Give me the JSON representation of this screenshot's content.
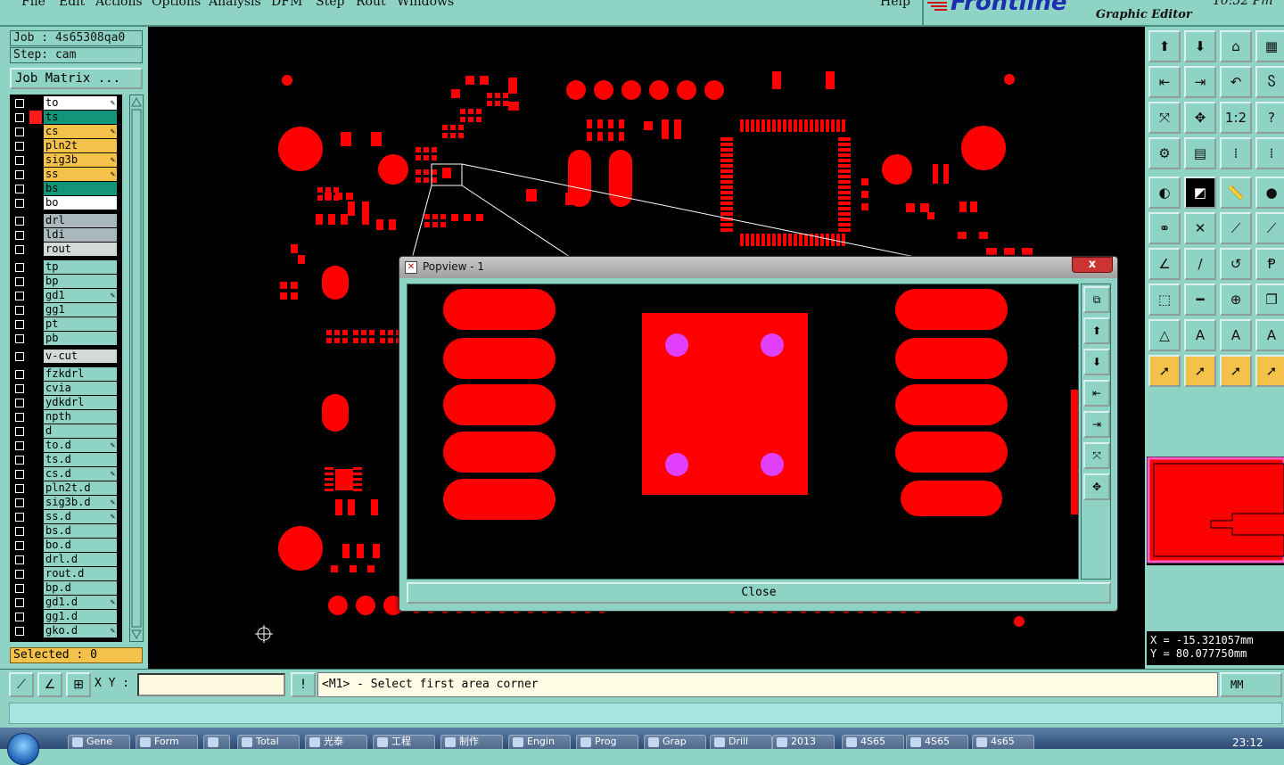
{
  "menu": {
    "items": [
      "File",
      "Edit",
      "Actions",
      "Options",
      "Analysis",
      "DFM",
      "Step",
      "Rout",
      "Windows"
    ],
    "help": "Help"
  },
  "brand": {
    "logo": "Frontline",
    "subtitle": "Graphic Editor",
    "clock": "10:52 Pm"
  },
  "job": {
    "job_line": "Job : 4s65308qa0",
    "step_line": "Step: cam",
    "matrix_button": "Job Matrix ..."
  },
  "layers": [
    {
      "name": "to",
      "bg": "#ffffff",
      "mark": "#000000",
      "edit": true
    },
    {
      "name": "ts",
      "bg": "#12967a",
      "mark": "#ff1a1a",
      "edit": false
    },
    {
      "name": "cs",
      "bg": "#f4c24a",
      "mark": "#000000",
      "edit": true
    },
    {
      "name": "pln2t",
      "bg": "#f4c24a",
      "mark": "#000000",
      "edit": false
    },
    {
      "name": "sig3b",
      "bg": "#f4c24a",
      "mark": "#000000",
      "edit": true
    },
    {
      "name": "ss",
      "bg": "#f4c24a",
      "mark": "#000000",
      "edit": true
    },
    {
      "name": "bs",
      "bg": "#12967a",
      "mark": "#000000",
      "edit": false
    },
    {
      "name": "bo",
      "bg": "#ffffff",
      "mark": "#000000",
      "edit": false
    },
    {
      "name": "drl",
      "bg": "#a9b8bc",
      "mark": "#000000",
      "edit": false
    },
    {
      "name": "ldi",
      "bg": "#a9b8bc",
      "mark": "#000000",
      "edit": false
    },
    {
      "name": "rout",
      "bg": "#d5d8d8",
      "mark": "#000000",
      "edit": false
    },
    {
      "name": "tp",
      "bg": "#8fd3c4",
      "mark": "#000000",
      "edit": false
    },
    {
      "name": "bp",
      "bg": "#8fd3c4",
      "mark": "#000000",
      "edit": false
    },
    {
      "name": "gd1",
      "bg": "#8fd3c4",
      "mark": "#000000",
      "edit": true
    },
    {
      "name": "gg1",
      "bg": "#8fd3c4",
      "mark": "#000000",
      "edit": false
    },
    {
      "name": "pt",
      "bg": "#8fd3c4",
      "mark": "#000000",
      "edit": false
    },
    {
      "name": "pb",
      "bg": "#8fd3c4",
      "mark": "#000000",
      "edit": false
    },
    {
      "name": "v-cut",
      "bg": "#d5d8d8",
      "mark": "#000000",
      "edit": false
    },
    {
      "name": "fzkdrl",
      "bg": "#8fd3c4",
      "mark": "#000000",
      "edit": false
    },
    {
      "name": "cvia",
      "bg": "#8fd3c4",
      "mark": "#000000",
      "edit": false
    },
    {
      "name": "ydkdrl",
      "bg": "#8fd3c4",
      "mark": "#000000",
      "edit": false
    },
    {
      "name": "npth",
      "bg": "#8fd3c4",
      "mark": "#000000",
      "edit": false
    },
    {
      "name": "d",
      "bg": "#8fd3c4",
      "mark": "#000000",
      "edit": false
    },
    {
      "name": "to.d",
      "bg": "#8fd3c4",
      "mark": "#000000",
      "edit": true
    },
    {
      "name": "ts.d",
      "bg": "#8fd3c4",
      "mark": "#000000",
      "edit": false
    },
    {
      "name": "cs.d",
      "bg": "#8fd3c4",
      "mark": "#000000",
      "edit": true
    },
    {
      "name": "pln2t.d",
      "bg": "#8fd3c4",
      "mark": "#000000",
      "edit": false
    },
    {
      "name": "sig3b.d",
      "bg": "#8fd3c4",
      "mark": "#000000",
      "edit": true
    },
    {
      "name": "ss.d",
      "bg": "#8fd3c4",
      "mark": "#000000",
      "edit": true
    },
    {
      "name": "bs.d",
      "bg": "#8fd3c4",
      "mark": "#000000",
      "edit": false
    },
    {
      "name": "bo.d",
      "bg": "#8fd3c4",
      "mark": "#000000",
      "edit": false
    },
    {
      "name": "drl.d",
      "bg": "#8fd3c4",
      "mark": "#000000",
      "edit": false
    },
    {
      "name": "rout.d",
      "bg": "#8fd3c4",
      "mark": "#000000",
      "edit": false
    },
    {
      "name": "bp.d",
      "bg": "#8fd3c4",
      "mark": "#000000",
      "edit": false
    },
    {
      "name": "gd1.d",
      "bg": "#8fd3c4",
      "mark": "#000000",
      "edit": true
    },
    {
      "name": "gg1.d",
      "bg": "#8fd3c4",
      "mark": "#000000",
      "edit": false
    },
    {
      "name": "gko.d",
      "bg": "#8fd3c4",
      "mark": "#000000",
      "edit": true
    }
  ],
  "selected": "Selected : 0",
  "popview": {
    "title": "Popview - 1",
    "close_button": "Close",
    "close_x": "x"
  },
  "right_tools": [
    {
      "icon": "open-job-icon",
      "glyph": "⬆"
    },
    {
      "icon": "save-icon",
      "glyph": "⬇"
    },
    {
      "icon": "home-icon",
      "glyph": "⌂"
    },
    {
      "icon": "matrix-icon",
      "glyph": "▦"
    },
    {
      "icon": "zoom-in-icon",
      "glyph": "⇤"
    },
    {
      "icon": "zoom-out-icon",
      "glyph": "⇥"
    },
    {
      "icon": "undo-view-icon",
      "glyph": "↶"
    },
    {
      "icon": "snap-icon",
      "glyph": "Ⴝ"
    },
    {
      "icon": "fit-icon",
      "glyph": "⤧"
    },
    {
      "icon": "center-icon",
      "glyph": "✥"
    },
    {
      "icon": "scale-icon",
      "glyph": "1:2"
    },
    {
      "icon": "help-icon",
      "glyph": "?"
    },
    {
      "icon": "measure-icon",
      "glyph": "⚙"
    },
    {
      "icon": "grid-icon",
      "glyph": "▤"
    },
    {
      "icon": "layers-red-icon",
      "glyph": "⁞"
    },
    {
      "icon": "layers-red2-icon",
      "glyph": "⁞"
    },
    {
      "icon": "pad-icon",
      "glyph": "◐"
    },
    {
      "icon": "surface-icon",
      "glyph": "◩"
    },
    {
      "icon": "ruler-icon",
      "glyph": "📏"
    },
    {
      "icon": "dot-icon",
      "glyph": "●"
    },
    {
      "icon": "route-icon",
      "glyph": "⚭"
    },
    {
      "icon": "cross-icon",
      "glyph": "✕"
    },
    {
      "icon": "line-icon",
      "glyph": "⟋"
    },
    {
      "icon": "line2-icon",
      "glyph": "⟋"
    },
    {
      "icon": "angle-icon",
      "glyph": "∠"
    },
    {
      "icon": "slash-icon",
      "glyph": "/"
    },
    {
      "icon": "arc-icon",
      "glyph": "↺"
    },
    {
      "icon": "text-icon",
      "glyph": "Ᵽ"
    },
    {
      "icon": "move-icon",
      "glyph": "⬚"
    },
    {
      "icon": "minus-icon",
      "glyph": "━"
    },
    {
      "icon": "connect-icon",
      "glyph": "⊕"
    },
    {
      "icon": "copy-icon",
      "glyph": "❐"
    },
    {
      "icon": "poly-icon",
      "glyph": "△"
    },
    {
      "icon": "poly2-icon",
      "glyph": "A"
    },
    {
      "icon": "poly3-icon",
      "glyph": "A"
    },
    {
      "icon": "poly4-icon",
      "glyph": "A"
    },
    {
      "icon": "select-icon",
      "glyph": "➚"
    },
    {
      "icon": "select2-icon",
      "glyph": "➚"
    },
    {
      "icon": "select3-icon",
      "glyph": "➚"
    },
    {
      "icon": "select4-icon",
      "glyph": "➚"
    }
  ],
  "coords": {
    "x": "X = -15.321057mm",
    "y": "Y = 80.077750mm"
  },
  "command": {
    "xy_label": "X Y :",
    "xy_value": "",
    "bang": "!",
    "prompt": "<M1> - Select first area corner",
    "units": "MM"
  },
  "taskbar": {
    "items": [
      "Gene",
      "Form",
      "",
      "Total",
      "光泰",
      "工程",
      "制作",
      "Engin",
      "Prog",
      "Grap",
      "Drill",
      "2013",
      "4S65",
      "4S65",
      "4s65"
    ],
    "time": "23:12"
  },
  "colors": {
    "copper": "#ff0000",
    "drill": "#e040fb",
    "panel": "#8fd3c4",
    "canvas": "#000000"
  }
}
